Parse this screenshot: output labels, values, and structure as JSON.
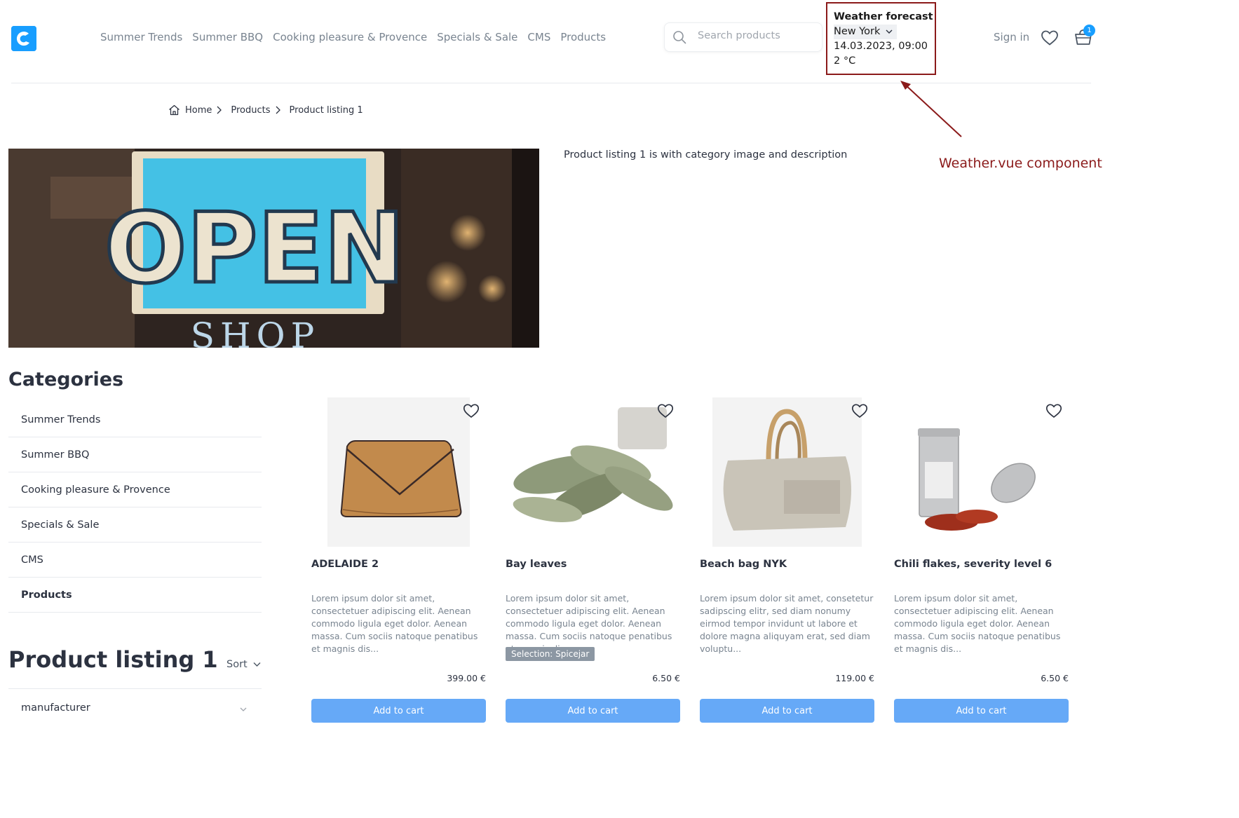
{
  "header": {
    "nav_items": [
      "Summer Trends",
      "Summer BBQ",
      "Cooking pleasure & Provence",
      "Specials & Sale",
      "CMS",
      "Products"
    ],
    "search_placeholder": "Search products",
    "weather": {
      "title": "Weather forecast",
      "city": "New York",
      "datetime": "14.03.2023, 09:00",
      "temperature": "2 °C"
    },
    "sign_in": "Sign in",
    "cart_count": "1",
    "icons": [
      "logo-icon",
      "search-icon",
      "chevron-down-icon",
      "heart-icon",
      "cart-icon"
    ]
  },
  "breadcrumb": [
    "Home",
    "Products",
    "Product listing 1"
  ],
  "annotation": {
    "label": "Weather.vue component",
    "color": "#8b1a1a"
  },
  "hero": {
    "sign_text": "OPEN",
    "shop_text": "SHOP"
  },
  "category": {
    "description": "Product listing 1 is with category image and description"
  },
  "sidebar": {
    "title": "Categories",
    "items": [
      "Summer Trends",
      "Summer BBQ",
      "Cooking pleasure & Provence",
      "Specials & Sale",
      "CMS",
      "Products"
    ],
    "active": "Products"
  },
  "listing": {
    "title": "Product listing 1",
    "sort_label": "Sort",
    "filter_label": "manufacturer"
  },
  "products": [
    {
      "name": "ADELAIDE 2",
      "description": "Lorem ipsum dolor sit amet, consectetuer adipiscing elit. Aenean commodo ligula eget dolor. Aenean massa. Cum sociis natoque penatibus et magnis dis...",
      "badge": "",
      "price": "399.00 €",
      "button": "Add to cart"
    },
    {
      "name": "Bay leaves",
      "description": "Lorem ipsum dolor sit amet, consectetuer adipiscing elit. Aenean commodo ligula eget dolor. Aenean massa. Cum sociis natoque penatibus et magnis dis...",
      "badge": "Selection: Spicejar",
      "price": "6.50 €",
      "button": "Add to cart"
    },
    {
      "name": "Beach bag NYK",
      "description": "Lorem ipsum dolor sit amet, consetetur sadipscing elitr, sed diam nonumy eirmod tempor invidunt ut labore et dolore magna aliquyam erat, sed diam voluptu...",
      "badge": "",
      "price": "119.00 €",
      "button": "Add to cart"
    },
    {
      "name": "Chili flakes, severity level 6",
      "description": "Lorem ipsum dolor sit amet, consectetuer adipiscing elit. Aenean commodo ligula eget dolor. Aenean massa. Cum sociis natoque penatibus et magnis dis...",
      "badge": "",
      "price": "6.50 €",
      "button": "Add to cart"
    }
  ],
  "colors": {
    "brand": "#189eff",
    "button": "#66a9f7",
    "text": "#2c3240",
    "muted": "#798490"
  }
}
